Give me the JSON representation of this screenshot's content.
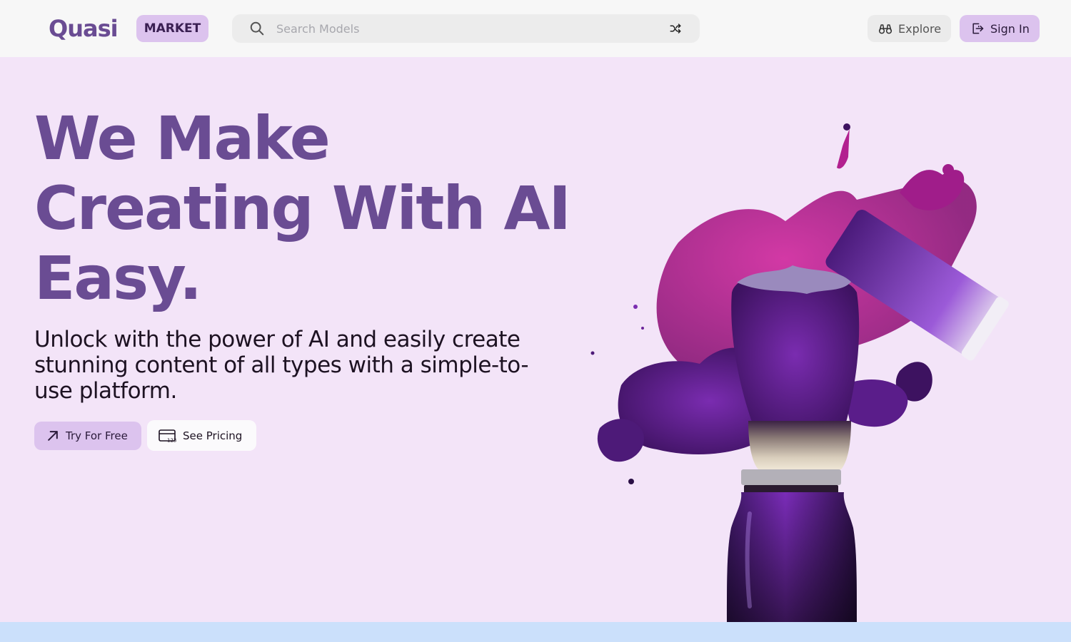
{
  "header": {
    "logo_text": "Quasi",
    "market_label": "MARKET",
    "search_placeholder": "Search Models",
    "explore_label": "Explore",
    "signin_label": "Sign In"
  },
  "hero": {
    "title": "We Make Creating With AI Easy.",
    "subtitle": "Unlock with the power of AI and easily create stunning content of all types with a simple-to-use platform.",
    "try_label": "Try For Free",
    "pricing_label": "See Pricing"
  },
  "icons": {
    "search": "search-icon",
    "shuffle": "shuffle-icon",
    "explore": "binoculars-icon",
    "signin": "sign-in-icon",
    "try": "arrow-up-right-icon",
    "pricing": "card-123-icon"
  },
  "colors": {
    "brand_purple": "#6a4c93",
    "accent_lavender": "#dcc3ee",
    "hero_background": "#f3e4f8",
    "header_background": "#f7f7f7",
    "bottom_strip": "#cbe0fb"
  }
}
